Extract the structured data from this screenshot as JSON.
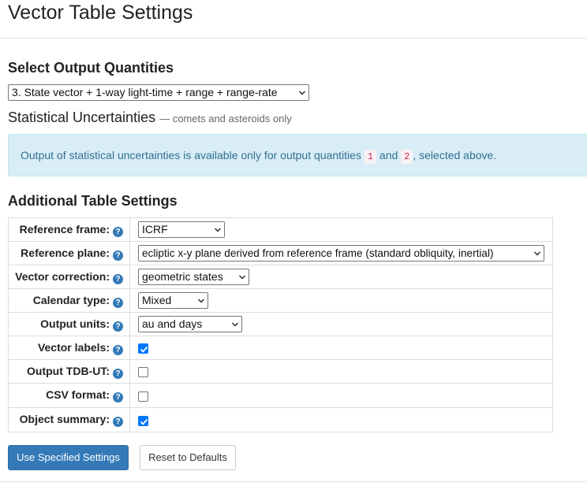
{
  "page": {
    "title": "Vector Table Settings"
  },
  "output_quantities": {
    "heading": "Select Output Quantities",
    "selected": "3. State vector + 1-way light-time + range + range-rate"
  },
  "uncertainties": {
    "heading": "Statistical Uncertainties",
    "subheading": "— comets and asteroids only",
    "alert_prefix": "Output of statistical uncertainties is available only for output quantities",
    "code1": "1",
    "alert_and": "and",
    "code2": "2",
    "alert_suffix": ", selected above."
  },
  "additional": {
    "heading": "Additional Table Settings",
    "help_icon_glyph": "?",
    "rows": {
      "reference_frame": {
        "label": "Reference frame:",
        "value": "ICRF"
      },
      "reference_plane": {
        "label": "Reference plane:",
        "value": "ecliptic x-y plane derived from reference frame (standard obliquity, inertial)"
      },
      "vector_correction": {
        "label": "Vector correction:",
        "value": "geometric states"
      },
      "calendar_type": {
        "label": "Calendar type:",
        "value": "Mixed"
      },
      "output_units": {
        "label": "Output units:",
        "value": "au and days"
      },
      "vector_labels": {
        "label": "Vector labels:",
        "checked": true
      },
      "output_tdb_ut": {
        "label": "Output TDB-UT:",
        "checked": false
      },
      "csv_format": {
        "label": "CSV format:",
        "checked": false
      },
      "object_summary": {
        "label": "Object summary:",
        "checked": true
      }
    }
  },
  "buttons": {
    "use_specified": "Use Specified Settings",
    "reset": "Reset to Defaults"
  },
  "colors": {
    "primary": "#337ab7",
    "alert_bg": "#d9edf7",
    "alert_text": "#31708f",
    "checkbox_on": "#0075ff"
  },
  "icons": {
    "help": "question-circle-icon",
    "select_caret": "chevron-down-icon",
    "checkmark": "check-icon"
  }
}
